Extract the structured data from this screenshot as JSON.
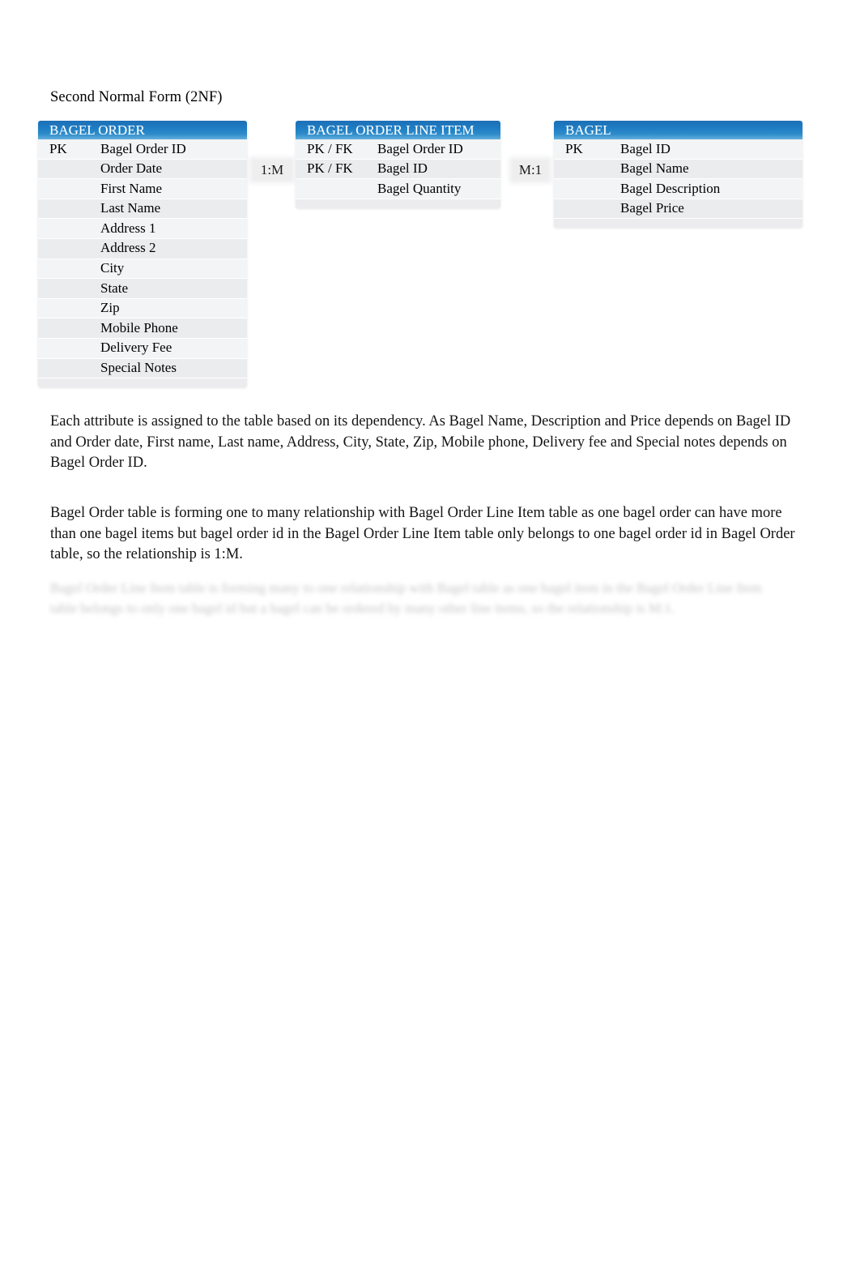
{
  "document": {
    "title": "Second Normal Form (2NF)"
  },
  "diagram": {
    "type": "entity-relationship-diagram",
    "header_color": "#1f7ec4",
    "row_color": "#f3f4f5",
    "entities": [
      {
        "name": "BAGEL ORDER",
        "attributes": [
          {
            "key": "PK",
            "name": "Bagel Order ID"
          },
          {
            "key": "",
            "name": "Order Date"
          },
          {
            "key": "",
            "name": "First Name"
          },
          {
            "key": "",
            "name": "Last Name"
          },
          {
            "key": "",
            "name": "Address 1"
          },
          {
            "key": "",
            "name": "Address 2"
          },
          {
            "key": "",
            "name": "City"
          },
          {
            "key": "",
            "name": "State"
          },
          {
            "key": "",
            "name": "Zip"
          },
          {
            "key": "",
            "name": "Mobile Phone"
          },
          {
            "key": "",
            "name": "Delivery Fee"
          },
          {
            "key": "",
            "name": "Special Notes"
          }
        ]
      },
      {
        "name": "BAGEL ORDER LINE ITEM",
        "attributes": [
          {
            "key": "PK / FK",
            "name": "Bagel Order ID"
          },
          {
            "key": "PK / FK",
            "name": "Bagel ID"
          },
          {
            "key": "",
            "name": "Bagel Quantity"
          }
        ]
      },
      {
        "name": "BAGEL",
        "attributes": [
          {
            "key": "PK",
            "name": "Bagel ID"
          },
          {
            "key": "",
            "name": "Bagel Name"
          },
          {
            "key": "",
            "name": "Bagel Description"
          },
          {
            "key": "",
            "name": "Bagel Price"
          }
        ]
      }
    ],
    "relationships": [
      {
        "label": "1:M",
        "from": "BAGEL ORDER",
        "to": "BAGEL ORDER LINE ITEM"
      },
      {
        "label": "M:1",
        "from": "BAGEL ORDER LINE ITEM",
        "to": "BAGEL"
      }
    ]
  },
  "body": {
    "paragraph_1": "Each attribute is assigned to the table based on its dependency. As Bagel Name, Description and Price depends on Bagel ID and Order date, First name, Last name, Address, City, State, Zip, Mobile phone, Delivery fee and Special notes depends on Bagel Order ID.",
    "paragraph_2": "Bagel Order table is forming one to many relationship with Bagel Order Line Item table as one bagel order can have more than one bagel items but bagel order id in the Bagel Order Line Item table only belongs to one bagel order id in Bagel Order table, so the relationship is 1:M.",
    "paragraph_3_blurred": "Bagel Order Line Item table is forming many to one relationship with Bagel table as one bagel item in the Bagel Order Line Item table belongs to only one bagel id but a bagel can be ordered by many other line items, so the relationship is M:1."
  }
}
